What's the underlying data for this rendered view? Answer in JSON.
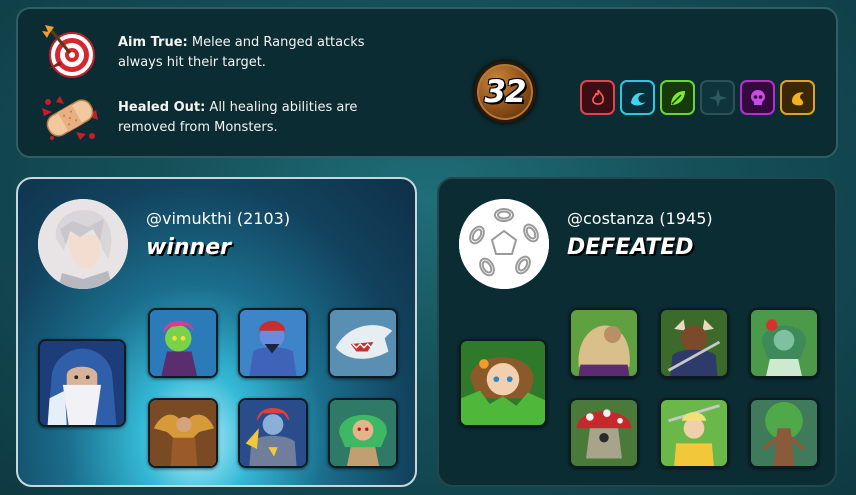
{
  "rules": [
    {
      "title": "Aim True:",
      "text": " Melee and Ranged attacks always hit their target.",
      "icon": "target-arrow-icon"
    },
    {
      "title": "Healed Out:",
      "text": " All healing abilities are removed from Monsters.",
      "icon": "bandage-icon"
    }
  ],
  "mana": "32",
  "splinters": [
    {
      "name": "fire",
      "icon": "fire-icon",
      "color": "#e0454f",
      "active": true
    },
    {
      "name": "water",
      "icon": "wave-icon",
      "color": "#2fc7e0",
      "active": true
    },
    {
      "name": "earth",
      "icon": "leaf-icon",
      "color": "#6ed62a",
      "active": true
    },
    {
      "name": "life",
      "icon": "star-icon",
      "color": "#2d5259",
      "active": false
    },
    {
      "name": "death",
      "icon": "skull-icon",
      "color": "#b52fd0",
      "active": true
    },
    {
      "name": "dragon",
      "icon": "dragon-eye-icon",
      "color": "#e0a31d",
      "active": true
    }
  ],
  "teams": [
    {
      "player": "@vimukthi (2103)",
      "result": "winner"
    },
    {
      "player": "@costanza (1945)",
      "result": "DEFEATED"
    }
  ]
}
